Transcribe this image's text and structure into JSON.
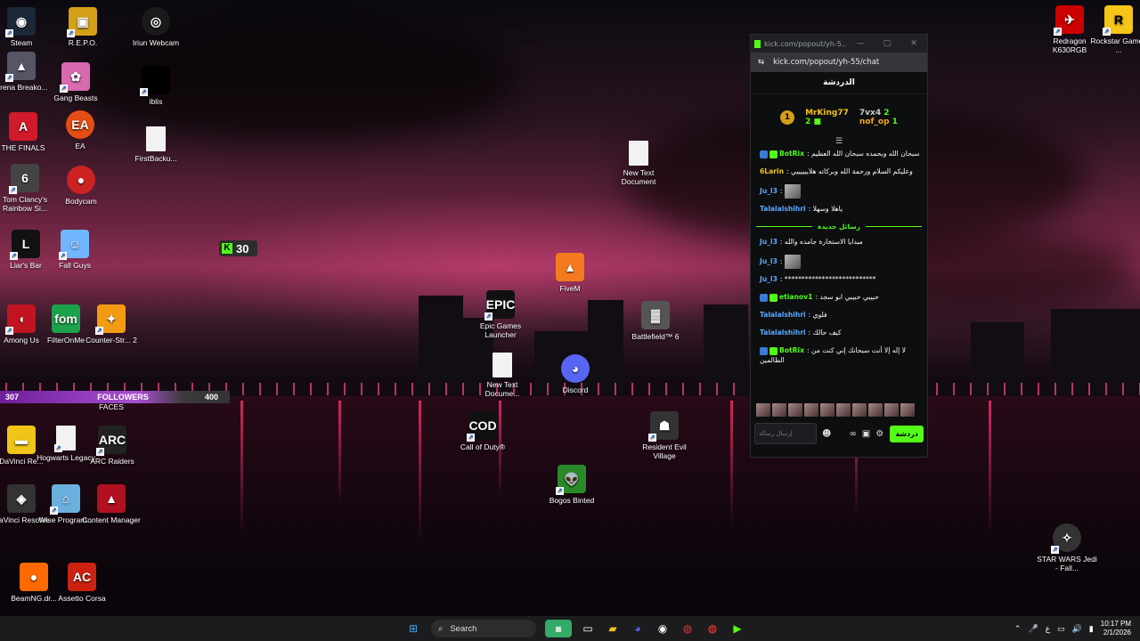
{
  "desktop": {
    "icons": [
      {
        "label": "Steam",
        "color": "#1b2838",
        "glyph": "◉"
      },
      {
        "label": "R.E.P.O.",
        "color": "#d4a017",
        "glyph": "▣"
      },
      {
        "label": "Iriun Webcam",
        "color": "#1a1a1a",
        "glyph": "◎"
      },
      {
        "label": "Arena Breako...",
        "color": "#556",
        "glyph": "▲"
      },
      {
        "label": "Gang Beasts",
        "color": "#d86ab0",
        "glyph": "✿"
      },
      {
        "label": "iblis",
        "color": "#000",
        "glyph": ""
      },
      {
        "label": "THE FINALS",
        "color": "#d11a2a",
        "glyph": "A"
      },
      {
        "label": "EA",
        "color": "#e44d13",
        "glyph": "EA"
      },
      {
        "label": "FirstBacku...",
        "color": "#fff",
        "glyph": ""
      },
      {
        "label": "Tom Clancy's Rainbow Si...",
        "color": "#444",
        "glyph": "6"
      },
      {
        "label": "Bodycam",
        "color": "#c22",
        "glyph": "●"
      },
      {
        "label": "Liar's Bar",
        "color": "#111",
        "glyph": "L"
      },
      {
        "label": "Fall Guys",
        "color": "#6fb6ff",
        "glyph": "☺"
      },
      {
        "label": "Among Us",
        "color": "#c0151f",
        "glyph": "◖"
      },
      {
        "label": "FilterOnMe",
        "color": "#1ca34a",
        "glyph": "fom"
      },
      {
        "label": "Counter-Str... 2",
        "color": "#f39c12",
        "glyph": "✦"
      },
      {
        "label": "DaVinci Re...",
        "color": "#f0c419",
        "glyph": "▬"
      },
      {
        "label": "Hogwarts Legacy",
        "color": "#fff",
        "glyph": ""
      },
      {
        "label": "ARC Raiders",
        "color": "#222",
        "glyph": "ARC"
      },
      {
        "label": "DaVinci Resolve",
        "color": "#333",
        "glyph": "◈"
      },
      {
        "label": "Wise Program...",
        "color": "#6ab0de",
        "glyph": "⌂"
      },
      {
        "label": "Content Manager",
        "color": "#b01020",
        "glyph": "▲"
      },
      {
        "label": "BeamNG.dr...",
        "color": "#ff6a00",
        "glyph": "●"
      },
      {
        "label": "Assetto Corsa",
        "color": "#c21",
        "glyph": "AC"
      },
      {
        "label": "New Text Document",
        "color": "#fff",
        "glyph": ""
      },
      {
        "label": "FiveM",
        "color": "#f47a20",
        "glyph": "▲"
      },
      {
        "label": "Epic Games Launcher",
        "color": "#111",
        "glyph": "EPIC"
      },
      {
        "label": "Battlefield™ 6",
        "color": "#555",
        "glyph": "▓"
      },
      {
        "label": "New Text Docume...",
        "color": "#fff",
        "glyph": ""
      },
      {
        "label": "Discord",
        "color": "#5865f2",
        "glyph": "◕"
      },
      {
        "label": "Call of Duty®",
        "color": "#111",
        "glyph": "COD"
      },
      {
        "label": "Resident Evil Village",
        "color": "#333",
        "glyph": "☗"
      },
      {
        "label": "Bogos Binted",
        "color": "#2a8a2a",
        "glyph": "👽"
      },
      {
        "label": "Redragon K630RGB",
        "color": "#c00",
        "glyph": "✈"
      },
      {
        "label": "Rockstar Games ...",
        "color": "#f5c518",
        "glyph": "R"
      },
      {
        "label": "STAR WARS Jedi - Fall...",
        "color": "#333",
        "glyph": "✧"
      },
      {
        "label": "FACES",
        "color": "transparent",
        "glyph": ""
      }
    ]
  },
  "overlay": {
    "kick_count": "30",
    "kick_letter": "K",
    "followers_left": "307",
    "followers_label": "FOLLOWERS",
    "followers_right": "400"
  },
  "chat": {
    "window_title": "kick.com/popout/yh-5...",
    "url": "kick.com/popout/yh-55/chat",
    "header": "الدردشة",
    "leaders": [
      {
        "name": "MrKing77",
        "count": "2"
      },
      {
        "name": "7vx4",
        "count": "2"
      },
      {
        "name": "nof_op",
        "count": "1"
      }
    ],
    "medal": "1",
    "messages": [
      {
        "user": "BotRix",
        "color": "#53fc18",
        "text": "سبحان الله وبحمده سبحان الله العظيم",
        "emote": false
      },
      {
        "user": "6Larin",
        "color": "#f5c518",
        "text": "وعليكم السلام ورحمة الله وبركاته هلاييييييي",
        "emote": false
      },
      {
        "user": "Ju_l3",
        "color": "#5aa9ff",
        "text": "",
        "emote": true
      },
      {
        "user": "Talalalshihri",
        "color": "#5aa9ff",
        "text": "ياهلا وسهلا",
        "emote": false
      }
    ],
    "new_messages_label": "رسائل جديدة",
    "messages2": [
      {
        "user": "Ju_l3",
        "color": "#5aa9ff",
        "text": "مبدايا الاستخارة جامده والله",
        "emote": false
      },
      {
        "user": "Ju_l3",
        "color": "#5aa9ff",
        "text": "",
        "emote": true
      },
      {
        "user": "Ju_l3",
        "color": "#5aa9ff",
        "text": "***************************",
        "emote": false
      },
      {
        "user": "etianov1",
        "color": "#53fc18",
        "text": "حبيبي حبيبي ابو سجد",
        "emote": false
      },
      {
        "user": "Talalalshihri",
        "color": "#5aa9ff",
        "text": "فلوي",
        "emote": false
      },
      {
        "user": "Talalalshihri",
        "color": "#5aa9ff",
        "text": "كيف حالك",
        "emote": false
      },
      {
        "user": "BotRix",
        "color": "#53fc18",
        "text": "لا إله إلا أنت سبحانك إني كنت من الظالمين",
        "emote": false
      }
    ],
    "input_placeholder": "إرسال رسالة",
    "send_label": "دردشة"
  },
  "taskbar": {
    "search_label": "Search",
    "time": "10:17 PM",
    "date": "2/1/2026",
    "lang": "ع"
  }
}
